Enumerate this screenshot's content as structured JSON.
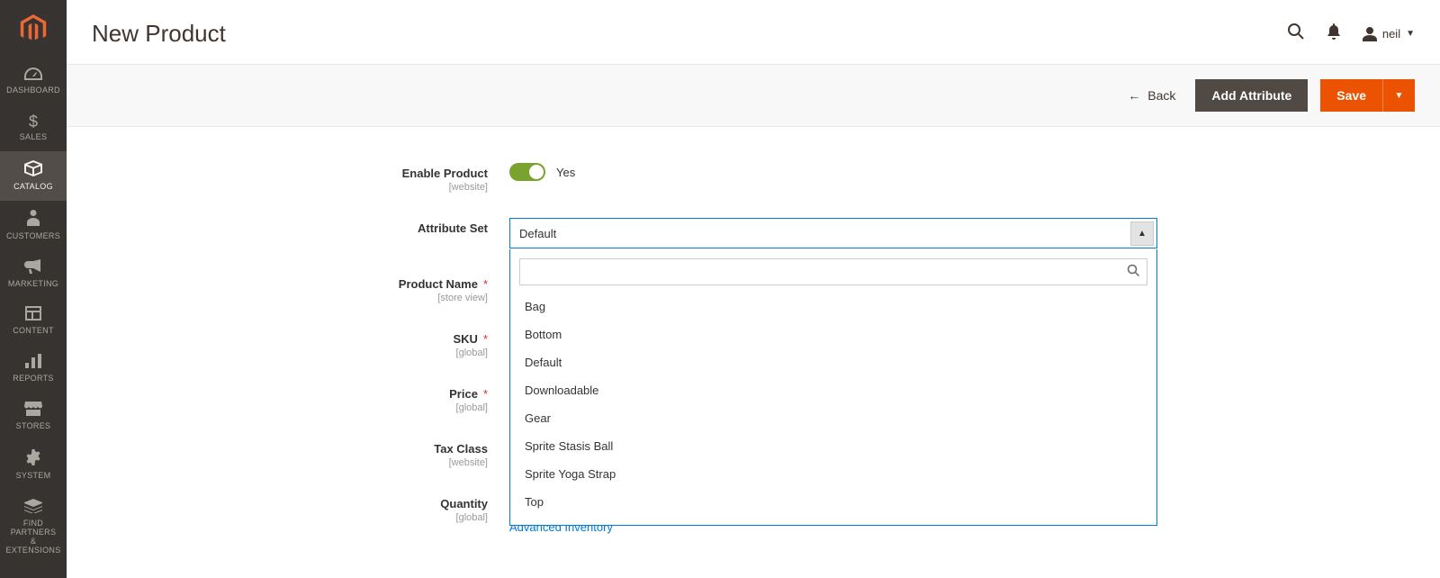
{
  "sidebar": {
    "items": [
      {
        "label": "DASHBOARD"
      },
      {
        "label": "SALES"
      },
      {
        "label": "CATALOG"
      },
      {
        "label": "CUSTOMERS"
      },
      {
        "label": "MARKETING"
      },
      {
        "label": "CONTENT"
      },
      {
        "label": "REPORTS"
      },
      {
        "label": "STORES"
      },
      {
        "label": "SYSTEM"
      },
      {
        "label": "FIND PARTNERS\n& EXTENSIONS"
      }
    ]
  },
  "header": {
    "title": "New Product",
    "user_name": "neil"
  },
  "actionbar": {
    "back_label": "Back",
    "add_attribute_label": "Add Attribute",
    "save_label": "Save"
  },
  "form": {
    "enable_product": {
      "label": "Enable Product",
      "scope": "[website]",
      "value_text": "Yes"
    },
    "attribute_set": {
      "label": "Attribute Set",
      "selected": "Default",
      "search_placeholder": "",
      "options": [
        "Bag",
        "Bottom",
        "Default",
        "Downloadable",
        "Gear",
        "Sprite Stasis Ball",
        "Sprite Yoga Strap",
        "Top"
      ]
    },
    "product_name": {
      "label": "Product Name",
      "scope": "[store view]"
    },
    "sku": {
      "label": "SKU",
      "scope": "[global]"
    },
    "price": {
      "label": "Price",
      "scope": "[global]"
    },
    "tax_class": {
      "label": "Tax Class",
      "scope": "[website]"
    },
    "quantity": {
      "label": "Quantity",
      "scope": "[global]",
      "advanced_link": "Advanced Inventory"
    }
  }
}
